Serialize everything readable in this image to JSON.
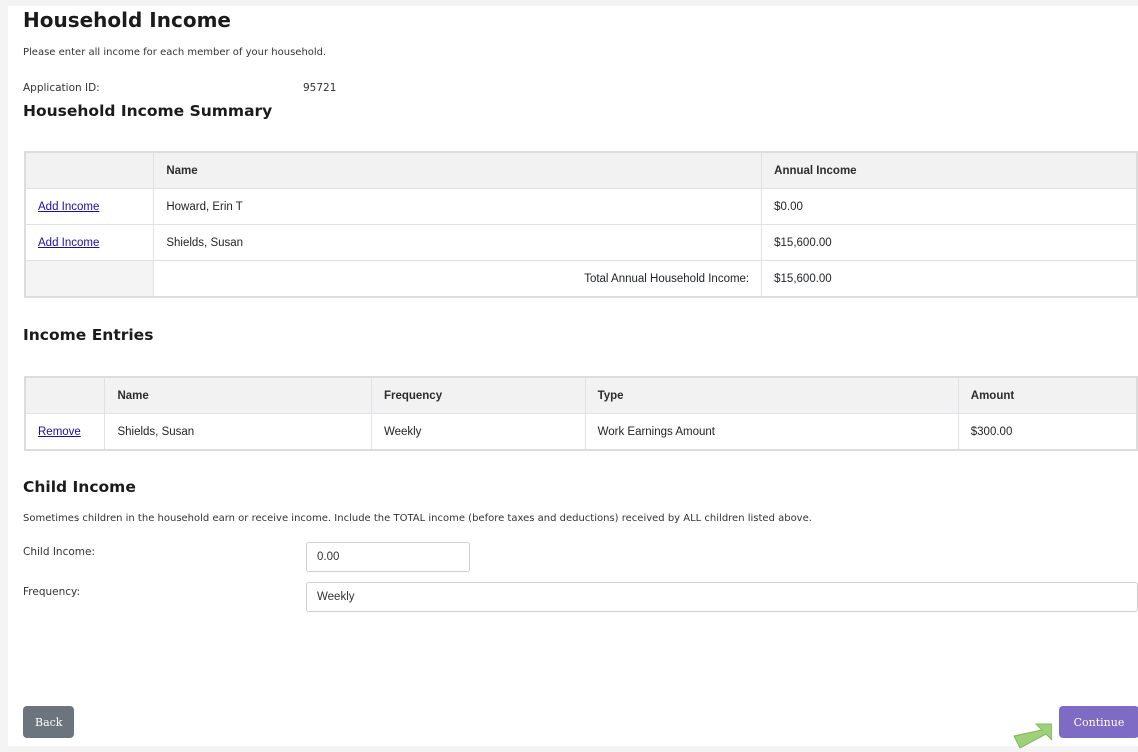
{
  "page": {
    "title": "Household Income",
    "intro": "Please enter all income for each member of your household.",
    "application_id_label": "Application ID:",
    "application_id_value": "95721"
  },
  "summary": {
    "heading": "Household Income Summary",
    "columns": [
      "",
      "Name",
      "Annual Income"
    ],
    "rows": [
      {
        "action": "Add Income",
        "name": "Howard, Erin T",
        "annual_income": "$0.00"
      },
      {
        "action": "Add Income",
        "name": "Shields, Susan",
        "annual_income": "$15,600.00"
      }
    ],
    "total_label": "Total Annual Household Income:",
    "total_value": "$15,600.00"
  },
  "entries": {
    "heading": "Income Entries",
    "columns": [
      "",
      "Name",
      "Frequency",
      "Type",
      "Amount"
    ],
    "rows": [
      {
        "action": "Remove",
        "name": "Shields, Susan",
        "frequency": "Weekly",
        "type": "Work Earnings Amount",
        "amount": "$300.00"
      }
    ]
  },
  "child_income": {
    "heading": "Child Income",
    "description": "Sometimes children in the household earn or receive income. Include the TOTAL income (before taxes and deductions) received by ALL children listed above.",
    "income_label": "Child Income:",
    "income_value": "0.00",
    "frequency_label": "Frequency:",
    "frequency_value": "Weekly"
  },
  "buttons": {
    "back": "Back",
    "continue": "Continue"
  },
  "colors": {
    "continue_button": "#7e6bc4",
    "back_button": "#6c757d",
    "link": "#1a0dab",
    "cursor": "#9ed17a"
  }
}
